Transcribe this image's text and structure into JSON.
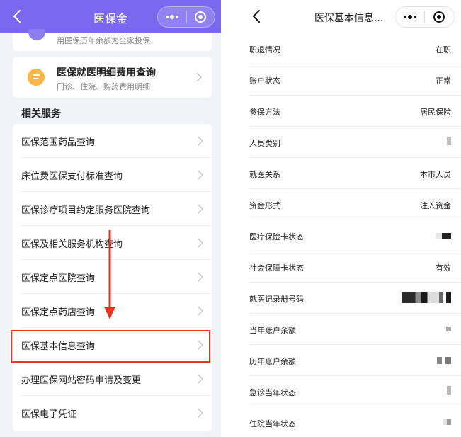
{
  "colors": {
    "accent": "#7a67ee",
    "highlight": "#e53320",
    "arrow": "#e53320"
  },
  "left": {
    "title": "医保金",
    "top_card": {
      "subtitle": "用医保历年余额为全家投保"
    },
    "detail_card": {
      "title": "医保就医明细费用查询",
      "subtitle": "门诊、住院、购药费用明细",
      "icon": "coin-icon"
    },
    "section_title": "相关服务",
    "services": [
      "医保范围药品查询",
      "床位费医保支付标准查询",
      "医保诊疗项目约定服务医院查询",
      "医保及相关服务机构查询",
      "医保定点医院查询",
      "医保定点药店查询",
      "医保基本信息查询",
      "办理医保网站密码申请及变更",
      "医保电子凭证"
    ],
    "highlighted_service": "医保基本信息查询"
  },
  "right": {
    "title": "医保基本信息...",
    "rows": [
      {
        "key": "职退情况",
        "value": "在职"
      },
      {
        "key": "账户状态",
        "value": "正常"
      },
      {
        "key": "参保方法",
        "value": "居民保险"
      },
      {
        "key": "人员类别",
        "value": ""
      },
      {
        "key": "就医关系",
        "value": "本市人员"
      },
      {
        "key": "资金形式",
        "value": "注入资金"
      },
      {
        "key": "医疗保险卡状态",
        "value": ""
      },
      {
        "key": "社会保障卡状态",
        "value": "有效"
      },
      {
        "key": "就医记录册号码",
        "value": ""
      },
      {
        "key": "当年账户余额",
        "value": ""
      },
      {
        "key": "历年账户余额",
        "value": ""
      },
      {
        "key": "急诊当年状态",
        "value": ""
      },
      {
        "key": "住院当年状态",
        "value": ""
      }
    ]
  }
}
